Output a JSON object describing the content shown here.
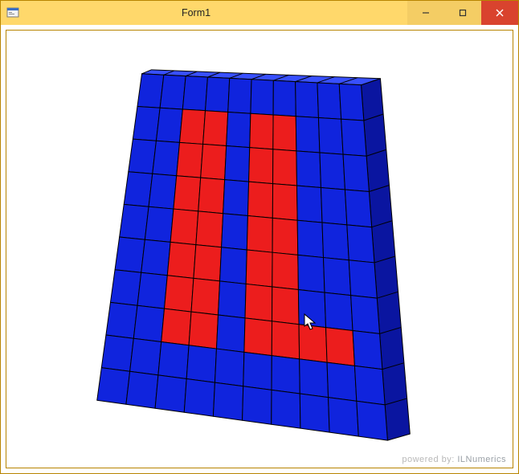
{
  "window": {
    "title": "Form1",
    "controls": {
      "minimize_glyph": "—",
      "maximize_glyph": "▢",
      "close_glyph": "✕"
    }
  },
  "footer": {
    "powered_label": "powered by:",
    "brand": "ILNumerics"
  },
  "cube": {
    "grid_size": 10,
    "colors": {
      "blue": "#1024dd",
      "blue_shade_right": "#0a15a0",
      "blue_shade_top": "#3850ff",
      "red": "#ec1d1d",
      "grid_line": "#000000"
    },
    "pattern_rows_top_to_bottom": [
      [
        0,
        0,
        0,
        0,
        0,
        0,
        0,
        0,
        0,
        0
      ],
      [
        0,
        0,
        1,
        1,
        0,
        1,
        1,
        0,
        0,
        0
      ],
      [
        0,
        0,
        1,
        1,
        0,
        1,
        1,
        0,
        0,
        0
      ],
      [
        0,
        0,
        1,
        1,
        0,
        1,
        1,
        0,
        0,
        0
      ],
      [
        0,
        0,
        1,
        1,
        0,
        1,
        1,
        0,
        0,
        0
      ],
      [
        0,
        0,
        1,
        1,
        0,
        1,
        1,
        0,
        0,
        0
      ],
      [
        0,
        0,
        1,
        1,
        0,
        1,
        1,
        0,
        0,
        0
      ],
      [
        0,
        0,
        1,
        1,
        0,
        1,
        1,
        1,
        1,
        0
      ],
      [
        0,
        0,
        0,
        0,
        0,
        0,
        0,
        0,
        0,
        0
      ],
      [
        0,
        0,
        0,
        0,
        0,
        0,
        0,
        0,
        0,
        0
      ]
    ]
  }
}
